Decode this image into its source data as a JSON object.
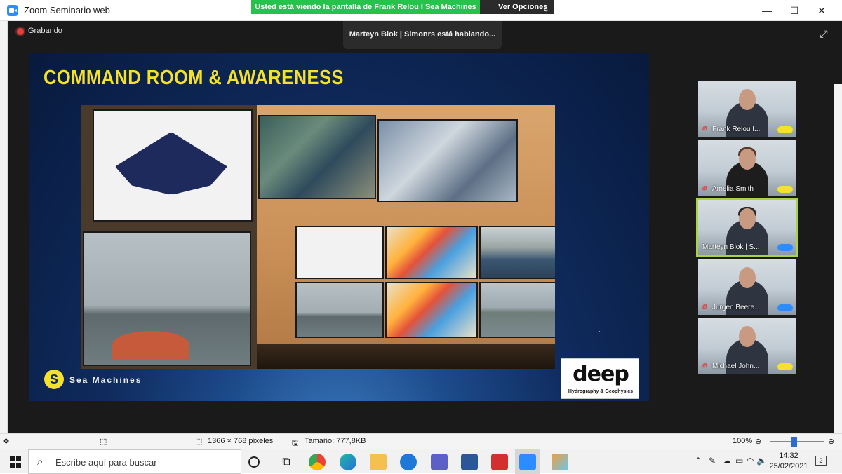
{
  "window": {
    "title": "Zoom Seminario web",
    "share_banner": "Usted está viendo la pantalla de Frank Relou I Sea Machines",
    "view_options": "Ver Opciones"
  },
  "meeting": {
    "recording_label": "Grabando",
    "speaking": "Marteyn Blok | Simonrs está hablando..."
  },
  "slide": {
    "title": "COMMAND ROOM & AWARENESS",
    "left_logo_text": "Sea Machines",
    "right_logo_word": "deep",
    "right_logo_sub": "Hydrography & Geophysics"
  },
  "participants": [
    {
      "name": "Frank Relou I...",
      "muted": true,
      "active": false,
      "logo": "sea-machines"
    },
    {
      "name": "Amelia Smith",
      "muted": true,
      "active": false,
      "logo": "sea-machines"
    },
    {
      "name": "Marteyn Blok | S...",
      "muted": false,
      "active": true,
      "logo": "deep"
    },
    {
      "name": "Jurgen Beere...",
      "muted": true,
      "active": false,
      "logo": "deep"
    },
    {
      "name": "Michael John...",
      "muted": true,
      "active": false,
      "logo": "sea-machines"
    }
  ],
  "statusbar": {
    "dimensions": "1366 × 768 píxeles",
    "size": "Tamaño: 777,8KB",
    "zoom": "100%",
    "zoom_level": 0.45
  },
  "taskbar": {
    "search_placeholder": "Escribe aquí para buscar",
    "time": "14:32",
    "date": "25/02/2021",
    "notifications": "2"
  },
  "colors": {
    "zoom_blue": "#2d8cff",
    "share_green": "#27c24c",
    "slide_title": "#f5e02a",
    "active_speaker": "#a8d43f",
    "rec_red": "#e0433f"
  }
}
